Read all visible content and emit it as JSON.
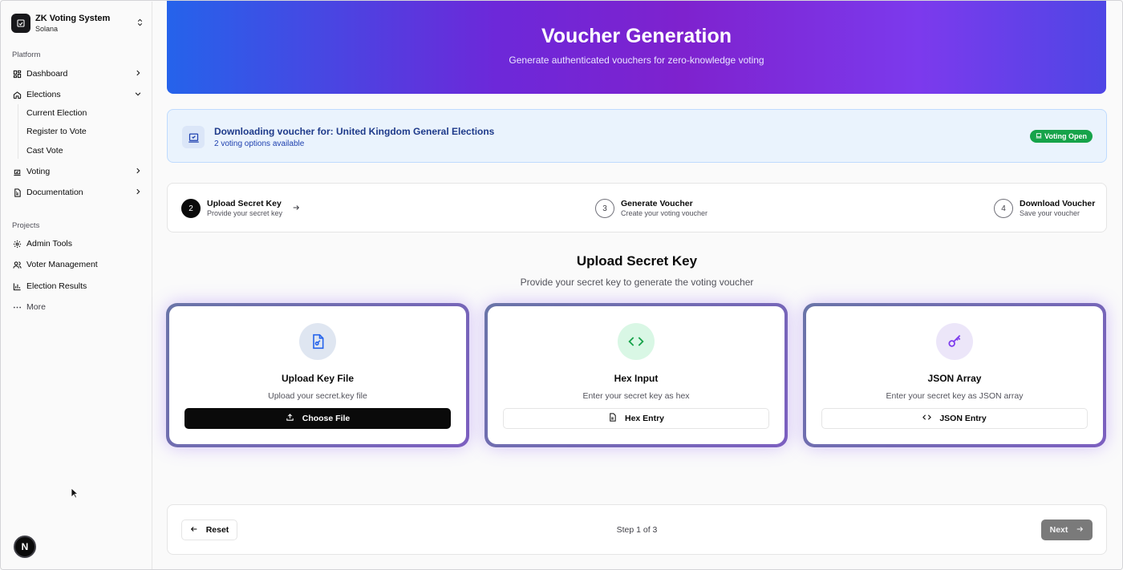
{
  "sidebar": {
    "brand_title": "ZK Voting System",
    "brand_subtitle": "Solana",
    "platform_label": "Platform",
    "projects_label": "Projects",
    "dashboard": "Dashboard",
    "elections": "Elections",
    "elections_sub": [
      "Current Election",
      "Register to Vote",
      "Cast Vote"
    ],
    "voting": "Voting",
    "documentation": "Documentation",
    "admin_tools": "Admin Tools",
    "voter_management": "Voter Management",
    "election_results": "Election Results",
    "more": "More",
    "badge_letter": "N"
  },
  "hero": {
    "title": "Voucher Generation",
    "subtitle": "Generate authenticated vouchers for zero-knowledge voting"
  },
  "info": {
    "title": "Downloading voucher for: United Kingdom General Elections",
    "subtitle": "2 voting options available",
    "status_badge": "Voting Open"
  },
  "steps": [
    {
      "number": "2",
      "title": "Upload Secret Key",
      "subtitle": "Provide your secret key"
    },
    {
      "number": "3",
      "title": "Generate Voucher",
      "subtitle": "Create your voting voucher"
    },
    {
      "number": "4",
      "title": "Download Voucher",
      "subtitle": "Save your voucher"
    }
  ],
  "section": {
    "title": "Upload Secret Key",
    "subtitle": "Provide your secret key to generate the voting voucher"
  },
  "options": [
    {
      "title": "Upload Key File",
      "subtitle": "Upload your secret.key file",
      "button": "Choose File"
    },
    {
      "title": "Hex Input",
      "subtitle": "Enter your secret key as hex",
      "button": "Hex Entry"
    },
    {
      "title": "JSON Array",
      "subtitle": "Enter your secret key as JSON array",
      "button": "JSON Entry"
    }
  ],
  "footer": {
    "reset": "Reset",
    "step_count": "Step 1 of 3",
    "next": "Next"
  },
  "colors": {
    "hero_start": "#2563eb",
    "hero_mid": "#7e22ce",
    "status_green": "#16a34a",
    "primary": "#0a0a0a"
  }
}
